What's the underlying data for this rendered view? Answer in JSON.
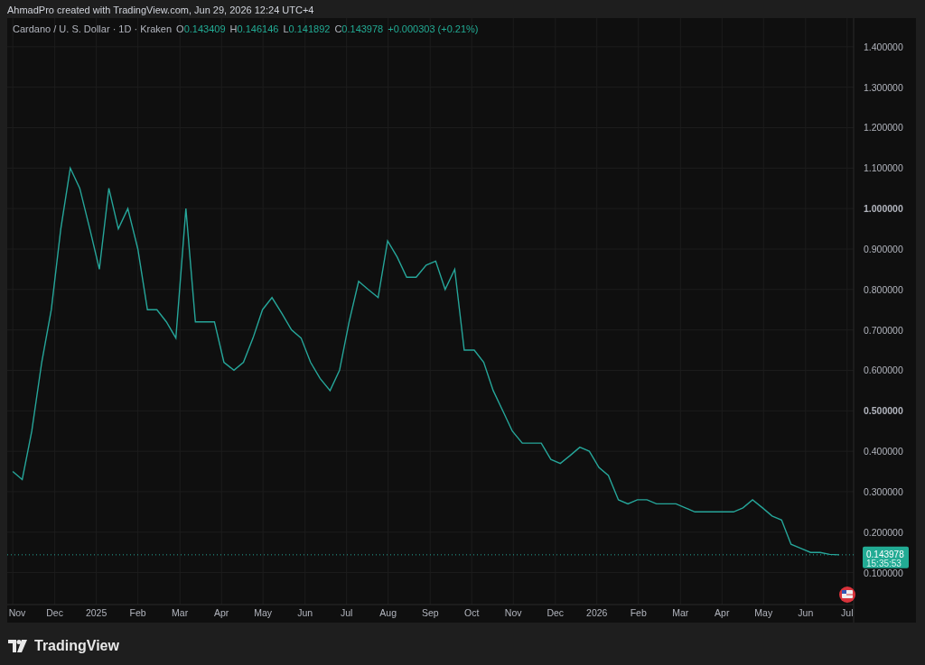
{
  "attribution": "AhmadPro created with TradingView.com, Jun 29, 2026 12:24 UTC+4",
  "legend": {
    "symbol": "Cardano / U. S. Dollar · 1D · Kraken",
    "fields": [
      {
        "label": "O",
        "value": "0.143409"
      },
      {
        "label": "H",
        "value": "0.146146"
      },
      {
        "label": "L",
        "value": "0.141892"
      },
      {
        "label": "C",
        "value": "0.143978"
      }
    ],
    "change": "+0.000303 (+0.21%)"
  },
  "price_label": {
    "price": "0.143978",
    "countdown": "15:35:53"
  },
  "chart_data": {
    "type": "line",
    "grid": true,
    "ref_lines": [
      {
        "axis": "y",
        "value": 0.143978
      }
    ],
    "ylim": [
      0.021,
      1.471
    ],
    "xlim": [
      2024.822,
      2026.513
    ],
    "yticks": [
      {
        "value": 0.1,
        "label": "0.100000"
      },
      {
        "value": 0.2,
        "label": "0.200000"
      },
      {
        "value": 0.3,
        "label": "0.300000"
      },
      {
        "value": 0.4,
        "label": "0.400000"
      },
      {
        "value": 0.5,
        "label": "0.500000"
      },
      {
        "value": 0.6,
        "label": "0.600000"
      },
      {
        "value": 0.7,
        "label": "0.700000"
      },
      {
        "value": 0.8,
        "label": "0.800000"
      },
      {
        "value": 0.9,
        "label": "0.900000"
      },
      {
        "value": 1.0,
        "label": "1.000000"
      },
      {
        "value": 1.1,
        "label": "1.100000"
      },
      {
        "value": 1.2,
        "label": "1.200000"
      },
      {
        "value": 1.3,
        "label": "1.300000"
      },
      {
        "value": 1.4,
        "label": "1.400000"
      }
    ],
    "xticks": [
      {
        "value": 2024.833,
        "label": "Nov"
      },
      {
        "value": 2024.917,
        "label": "Dec"
      },
      {
        "value": 2025.0,
        "label": "2025"
      },
      {
        "value": 2025.083,
        "label": "Feb"
      },
      {
        "value": 2025.167,
        "label": "Mar"
      },
      {
        "value": 2025.25,
        "label": "Apr"
      },
      {
        "value": 2025.333,
        "label": "May"
      },
      {
        "value": 2025.417,
        "label": "Jun"
      },
      {
        "value": 2025.5,
        "label": "Jul"
      },
      {
        "value": 2025.583,
        "label": "Aug"
      },
      {
        "value": 2025.667,
        "label": "Sep"
      },
      {
        "value": 2025.75,
        "label": "Oct"
      },
      {
        "value": 2025.833,
        "label": "Nov"
      },
      {
        "value": 2025.917,
        "label": "Dec"
      },
      {
        "value": 2026.0,
        "label": "2026"
      },
      {
        "value": 2026.083,
        "label": "Feb"
      },
      {
        "value": 2026.167,
        "label": "Mar"
      },
      {
        "value": 2026.25,
        "label": "Apr"
      },
      {
        "value": 2026.333,
        "label": "May"
      },
      {
        "value": 2026.417,
        "label": "Jun"
      },
      {
        "value": 2026.5,
        "label": "Jul"
      }
    ],
    "x": [
      2024.833,
      2024.852,
      2024.871,
      2024.891,
      2024.91,
      2024.929,
      2024.948,
      2024.967,
      2024.987,
      2025.006,
      2025.025,
      2025.044,
      2025.063,
      2025.083,
      2025.102,
      2025.121,
      2025.14,
      2025.159,
      2025.179,
      2025.198,
      2025.217,
      2025.236,
      2025.255,
      2025.275,
      2025.294,
      2025.313,
      2025.332,
      2025.351,
      2025.371,
      2025.39,
      2025.409,
      2025.428,
      2025.447,
      2025.467,
      2025.486,
      2025.505,
      2025.524,
      2025.543,
      2025.563,
      2025.582,
      2025.601,
      2025.62,
      2025.639,
      2025.659,
      2025.678,
      2025.697,
      2025.716,
      2025.735,
      2025.755,
      2025.774,
      2025.793,
      2025.812,
      2025.831,
      2025.851,
      2025.87,
      2025.889,
      2025.908,
      2025.927,
      2025.947,
      2025.966,
      2025.985,
      2026.004,
      2026.023,
      2026.043,
      2026.062,
      2026.081,
      2026.1,
      2026.119,
      2026.139,
      2026.158,
      2026.177,
      2026.196,
      2026.215,
      2026.235,
      2026.254,
      2026.273,
      2026.292,
      2026.311,
      2026.331,
      2026.35,
      2026.369,
      2026.388,
      2026.407,
      2026.427,
      2026.446,
      2026.465,
      2026.484
    ],
    "series": [
      {
        "color": "#26a69a",
        "values": [
          0.35,
          0.33,
          0.45,
          0.62,
          0.75,
          0.95,
          1.1,
          1.05,
          0.95,
          0.85,
          1.05,
          0.95,
          1.0,
          0.9,
          0.75,
          0.75,
          0.72,
          0.68,
          1.0,
          0.72,
          0.72,
          0.72,
          0.62,
          0.6,
          0.62,
          0.68,
          0.75,
          0.78,
          0.74,
          0.7,
          0.68,
          0.62,
          0.58,
          0.55,
          0.6,
          0.72,
          0.82,
          0.8,
          0.78,
          0.92,
          0.88,
          0.83,
          0.83,
          0.86,
          0.87,
          0.8,
          0.85,
          0.65,
          0.65,
          0.62,
          0.55,
          0.5,
          0.45,
          0.42,
          0.42,
          0.42,
          0.38,
          0.37,
          0.39,
          0.41,
          0.4,
          0.36,
          0.34,
          0.28,
          0.27,
          0.28,
          0.28,
          0.27,
          0.27,
          0.27,
          0.26,
          0.25,
          0.25,
          0.25,
          0.25,
          0.25,
          0.26,
          0.28,
          0.26,
          0.24,
          0.23,
          0.17,
          0.16,
          0.15,
          0.15,
          0.145,
          0.144
        ]
      }
    ]
  },
  "logo": {
    "text": "TradingView"
  }
}
